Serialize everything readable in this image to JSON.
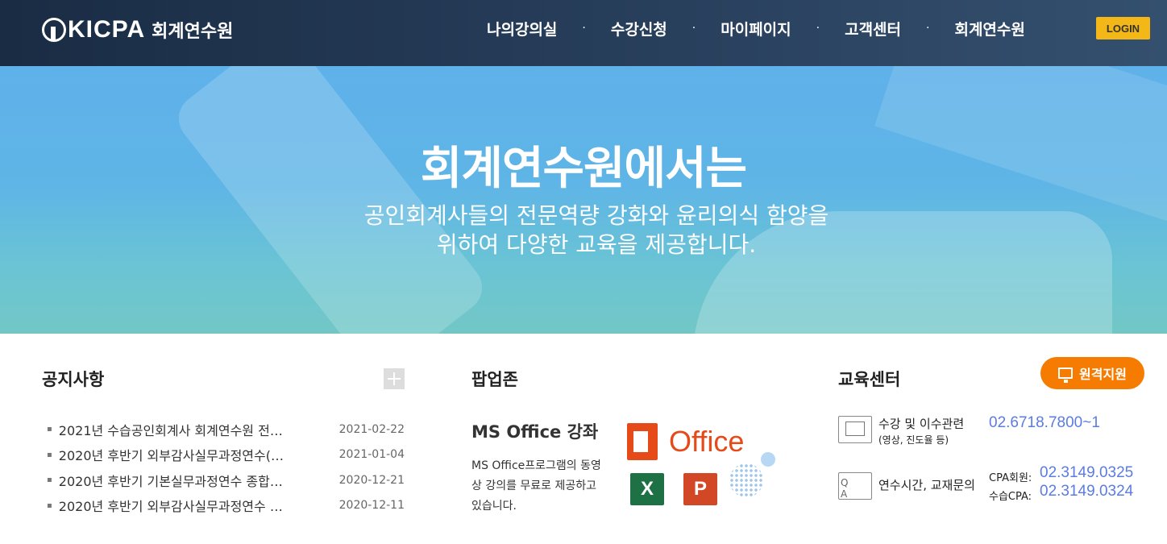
{
  "header": {
    "logo_text": "KICPA",
    "logo_sub": "회계연수원",
    "nav": [
      "나의강의실",
      "수강신청",
      "마이페이지",
      "고객센터",
      "회계연수원"
    ],
    "login_label": "LOGIN"
  },
  "hero": {
    "title": "회계연수원에서는",
    "subtitle_line1": "공인회계사들의 전문역량 강화와 윤리의식 함양을",
    "subtitle_line2": "위하여 다양한 교육을 제공합니다."
  },
  "notice": {
    "title": "공지사항",
    "items": [
      {
        "title": "2021년 수습공인회계사 회계연수원 전…",
        "date": "2021-02-22"
      },
      {
        "title": "2020년 후반기 외부감사실무과정연수(…",
        "date": "2021-01-04"
      },
      {
        "title": "2020년 후반기 기본실무과정연수 종합…",
        "date": "2020-12-21"
      },
      {
        "title": "2020년 후반기 외부감사실무과정연수 …",
        "date": "2020-12-11"
      }
    ]
  },
  "popup": {
    "title": "팝업존",
    "course_title": "MS Office 강좌",
    "course_desc": "MS Office프로그램의 동영상 강의를 무료로 제공하고 있습니다.",
    "office_text": "Office"
  },
  "edu": {
    "title": "교육센터",
    "remote_label": "원격지원",
    "row1_label": "수강 및 이수관련",
    "row1_sub": "(영상, 진도율 등)",
    "row1_phone": "02.6718.7800~1",
    "row2_label": "연수시간, 교재문의",
    "row2_lbl_a": "CPA회원:",
    "row2_phone_a": "02.3149.0325",
    "row2_lbl_b": "수습CPA:",
    "row2_phone_b": "02.3149.0324"
  },
  "colors": {
    "header_bg": "#1f334d",
    "login": "#f4b718",
    "remote": "#f57c00",
    "phone": "#5b7ce0"
  }
}
